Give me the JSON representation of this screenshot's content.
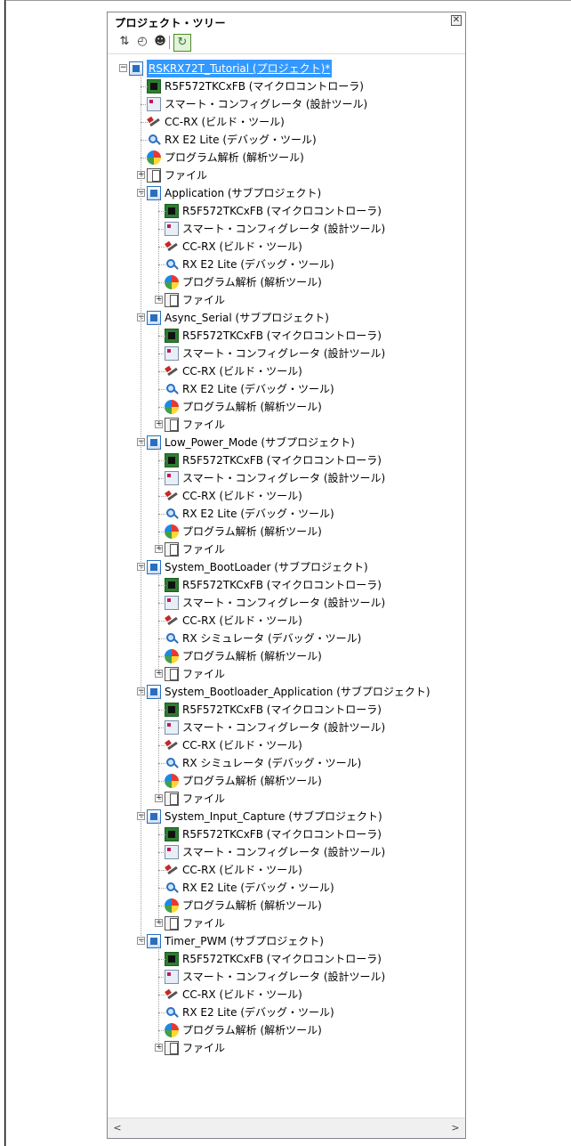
{
  "panel": {
    "title": "プロジェクト・ツリー",
    "close_glyph": "✕",
    "toolbar": [
      {
        "icon": "sort-icon",
        "glyph": "⇅"
      },
      {
        "icon": "properties-icon",
        "glyph": "◴"
      },
      {
        "icon": "user-icon",
        "glyph": "☻"
      },
      {
        "icon": "refresh-icon",
        "glyph": "↻"
      }
    ]
  },
  "tree": {
    "root": {
      "label": "RSKRX72T_Tutorial (プロジェクト)*",
      "icon": "project-icon",
      "expander": "−"
    },
    "root_items": [
      {
        "label": "R5F572TKCxFB (マイクロコントローラ)",
        "icon": "microcontroller-icon"
      },
      {
        "label": "スマート・コンフィグレータ (設計ツール)",
        "icon": "smart-configurator-icon"
      },
      {
        "label": "CC-RX (ビルド・ツール)",
        "icon": "build-tool-icon"
      },
      {
        "label": "RX E2 Lite (デバッグ・ツール)",
        "icon": "debug-tool-icon"
      },
      {
        "label": "プログラム解析 (解析ツール)",
        "icon": "analysis-tool-icon"
      },
      {
        "label": "ファイル",
        "icon": "file-icon",
        "expander": "+"
      }
    ],
    "subprojects": [
      {
        "label": "Application (サブプロジェクト)",
        "expander": "−",
        "items": [
          {
            "label": "R5F572TKCxFB (マイクロコントローラ)",
            "icon": "microcontroller-icon"
          },
          {
            "label": "スマート・コンフィグレータ (設計ツール)",
            "icon": "smart-configurator-icon"
          },
          {
            "label": "CC-RX (ビルド・ツール)",
            "icon": "build-tool-icon"
          },
          {
            "label": "RX E2 Lite (デバッグ・ツール)",
            "icon": "debug-tool-icon"
          },
          {
            "label": "プログラム解析 (解析ツール)",
            "icon": "analysis-tool-icon"
          },
          {
            "label": "ファイル",
            "icon": "file-icon",
            "expander": "+"
          }
        ]
      },
      {
        "label": "Async_Serial (サブプロジェクト)",
        "expander": "−",
        "items": [
          {
            "label": "R5F572TKCxFB (マイクロコントローラ)",
            "icon": "microcontroller-icon"
          },
          {
            "label": "スマート・コンフィグレータ (設計ツール)",
            "icon": "smart-configurator-icon"
          },
          {
            "label": "CC-RX (ビルド・ツール)",
            "icon": "build-tool-icon"
          },
          {
            "label": "RX E2 Lite (デバッグ・ツール)",
            "icon": "debug-tool-icon"
          },
          {
            "label": "プログラム解析 (解析ツール)",
            "icon": "analysis-tool-icon"
          },
          {
            "label": "ファイル",
            "icon": "file-icon",
            "expander": "+"
          }
        ]
      },
      {
        "label": "Low_Power_Mode (サブプロジェクト)",
        "expander": "−",
        "items": [
          {
            "label": "R5F572TKCxFB (マイクロコントローラ)",
            "icon": "microcontroller-icon"
          },
          {
            "label": "スマート・コンフィグレータ (設計ツール)",
            "icon": "smart-configurator-icon"
          },
          {
            "label": "CC-RX (ビルド・ツール)",
            "icon": "build-tool-icon"
          },
          {
            "label": "RX E2 Lite (デバッグ・ツール)",
            "icon": "debug-tool-icon"
          },
          {
            "label": "プログラム解析 (解析ツール)",
            "icon": "analysis-tool-icon"
          },
          {
            "label": "ファイル",
            "icon": "file-icon",
            "expander": "+"
          }
        ]
      },
      {
        "label": "System_BootLoader (サブプロジェクト)",
        "expander": "−",
        "items": [
          {
            "label": "R5F572TKCxFB (マイクロコントローラ)",
            "icon": "microcontroller-icon"
          },
          {
            "label": "スマート・コンフィグレータ (設計ツール)",
            "icon": "smart-configurator-icon"
          },
          {
            "label": "CC-RX (ビルド・ツール)",
            "icon": "build-tool-icon"
          },
          {
            "label": "RX シミュレータ (デバッグ・ツール)",
            "icon": "debug-tool-icon"
          },
          {
            "label": "プログラム解析 (解析ツール)",
            "icon": "analysis-tool-icon"
          },
          {
            "label": "ファイル",
            "icon": "file-icon",
            "expander": "+"
          }
        ]
      },
      {
        "label": "System_Bootloader_Application (サブプロジェクト)",
        "expander": "−",
        "items": [
          {
            "label": "R5F572TKCxFB (マイクロコントローラ)",
            "icon": "microcontroller-icon"
          },
          {
            "label": "スマート・コンフィグレータ (設計ツール)",
            "icon": "smart-configurator-icon"
          },
          {
            "label": "CC-RX (ビルド・ツール)",
            "icon": "build-tool-icon"
          },
          {
            "label": "RX シミュレータ (デバッグ・ツール)",
            "icon": "debug-tool-icon"
          },
          {
            "label": "プログラム解析 (解析ツール)",
            "icon": "analysis-tool-icon"
          },
          {
            "label": "ファイル",
            "icon": "file-icon",
            "expander": "+"
          }
        ]
      },
      {
        "label": "System_Input_Capture (サブプロジェクト)",
        "expander": "−",
        "items": [
          {
            "label": "R5F572TKCxFB (マイクロコントローラ)",
            "icon": "microcontroller-icon"
          },
          {
            "label": "スマート・コンフィグレータ (設計ツール)",
            "icon": "smart-configurator-icon"
          },
          {
            "label": "CC-RX (ビルド・ツール)",
            "icon": "build-tool-icon"
          },
          {
            "label": "RX E2 Lite (デバッグ・ツール)",
            "icon": "debug-tool-icon"
          },
          {
            "label": "プログラム解析 (解析ツール)",
            "icon": "analysis-tool-icon"
          },
          {
            "label": "ファイル",
            "icon": "file-icon",
            "expander": "+"
          }
        ]
      },
      {
        "label": "Timer_PWM (サブプロジェクト)",
        "expander": "−",
        "items": [
          {
            "label": "R5F572TKCxFB (マイクロコントローラ)",
            "icon": "microcontroller-icon"
          },
          {
            "label": "スマート・コンフィグレータ (設計ツール)",
            "icon": "smart-configurator-icon"
          },
          {
            "label": "CC-RX (ビルド・ツール)",
            "icon": "build-tool-icon"
          },
          {
            "label": "RX E2 Lite (デバッグ・ツール)",
            "icon": "debug-tool-icon"
          },
          {
            "label": "プログラム解析 (解析ツール)",
            "icon": "analysis-tool-icon"
          },
          {
            "label": "ファイル",
            "icon": "file-icon",
            "expander": "+"
          }
        ]
      }
    ]
  },
  "scrollbar": {
    "left_arrow": "<",
    "right_arrow": ">"
  },
  "colors": {
    "selection": "#3399ff",
    "border": "#828790"
  }
}
